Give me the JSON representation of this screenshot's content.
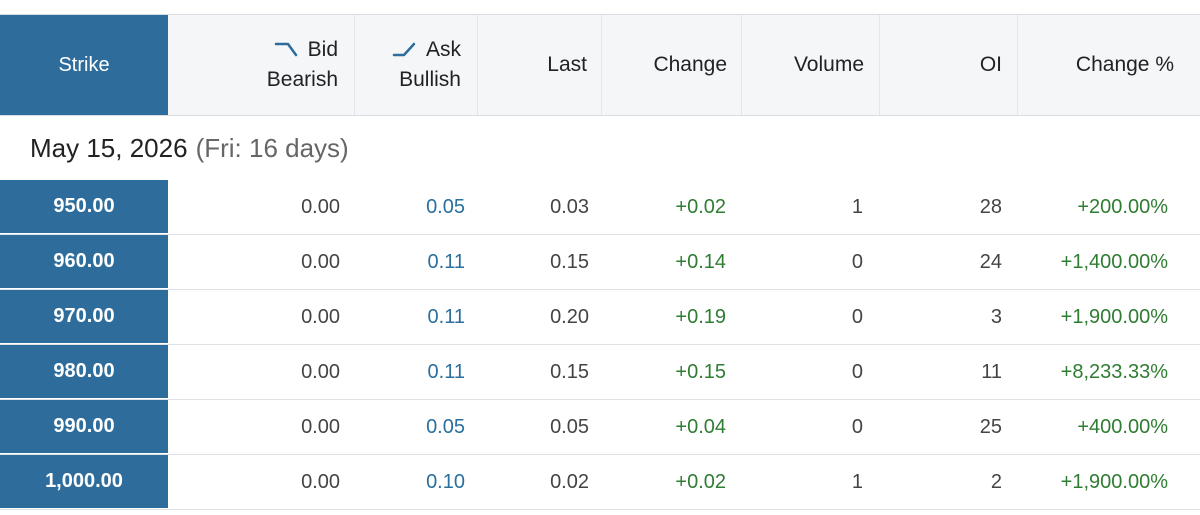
{
  "header": {
    "strike": "Strike",
    "bid_top": "Bid",
    "bid_bottom": "Bearish",
    "ask_top": "Ask",
    "ask_bottom": "Bullish",
    "last": "Last",
    "change": "Change",
    "volume": "Volume",
    "oi": "OI",
    "change_pct": "Change %",
    "bid_icon": "trend-down-icon",
    "ask_icon": "trend-up-icon"
  },
  "expiry": {
    "date": "May 15, 2026",
    "detail": "(Fri: 16 days)"
  },
  "rows": [
    {
      "strike": "950.00",
      "bid": "0.00",
      "ask": "0.05",
      "last": "0.03",
      "change": "+0.02",
      "volume": "1",
      "oi": "28",
      "change_pct": "+200.00%"
    },
    {
      "strike": "960.00",
      "bid": "0.00",
      "ask": "0.11",
      "last": "0.15",
      "change": "+0.14",
      "volume": "0",
      "oi": "24",
      "change_pct": "+1,400.00%"
    },
    {
      "strike": "970.00",
      "bid": "0.00",
      "ask": "0.11",
      "last": "0.20",
      "change": "+0.19",
      "volume": "0",
      "oi": "3",
      "change_pct": "+1,900.00%"
    },
    {
      "strike": "980.00",
      "bid": "0.00",
      "ask": "0.11",
      "last": "0.15",
      "change": "+0.15",
      "volume": "0",
      "oi": "11",
      "change_pct": "+8,233.33%"
    },
    {
      "strike": "990.00",
      "bid": "0.00",
      "ask": "0.05",
      "last": "0.05",
      "change": "+0.04",
      "volume": "0",
      "oi": "25",
      "change_pct": "+400.00%"
    },
    {
      "strike": "1,000.00",
      "bid": "0.00",
      "ask": "0.10",
      "last": "0.02",
      "change": "+0.02",
      "volume": "1",
      "oi": "2",
      "change_pct": "+1,900.00%"
    }
  ],
  "colors": {
    "strike_bg": "#2e6d9b",
    "positive": "#2f7d32",
    "ask_link": "#2a6f9e"
  }
}
